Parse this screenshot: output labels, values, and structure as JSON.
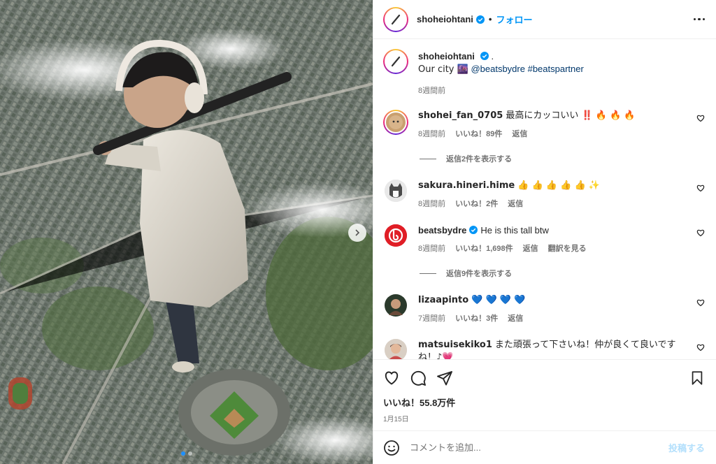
{
  "post": {
    "username": "shoheiohtani",
    "follow_label": "フォロー",
    "separator": "•"
  },
  "caption": {
    "username": "shoheiohtani",
    "dot": ".",
    "text_line": "Our city 🌆",
    "mentions": "@beatsbydre #beatspartner",
    "time": "8週間前"
  },
  "comments": [
    {
      "username": "shohei_fan_0705",
      "text": "最高にカッコいい ‼️ 🔥 🔥 🔥",
      "time": "8週間前",
      "likes": "いいね！89件",
      "reply": "返信",
      "replies_label": "返信2件を表示する"
    },
    {
      "username": "sakura.hineri.hime",
      "text": "👍 👍 👍 👍 👍 ✨",
      "time": "8週間前",
      "likes": "いいね！2件",
      "reply": "返信"
    },
    {
      "username": "beatsbydre",
      "text": "He is this tall btw",
      "time": "8週間前",
      "likes": "いいね！1,698件",
      "reply": "返信",
      "translate": "翻訳を見る",
      "replies_label": "返信9件を表示する"
    },
    {
      "username": "lizaapinto",
      "text": "💙 💙 💙 💙",
      "time": "7週間前",
      "likes": "いいね！3件",
      "reply": "返信"
    },
    {
      "username": "matsuisekiko1",
      "text": "また頑張って下さいね！仲が良くて良いです",
      "text_cont": "ね！♪💗"
    }
  ],
  "stats": {
    "likes": "いいね！55.8万件",
    "date": "1月15日"
  },
  "composer": {
    "placeholder": "コメントを追加...",
    "post_label": "投稿する"
  },
  "colors": {
    "accent": "#0095f6",
    "verified": "#0095f6",
    "beats_red": "#e01e26"
  }
}
